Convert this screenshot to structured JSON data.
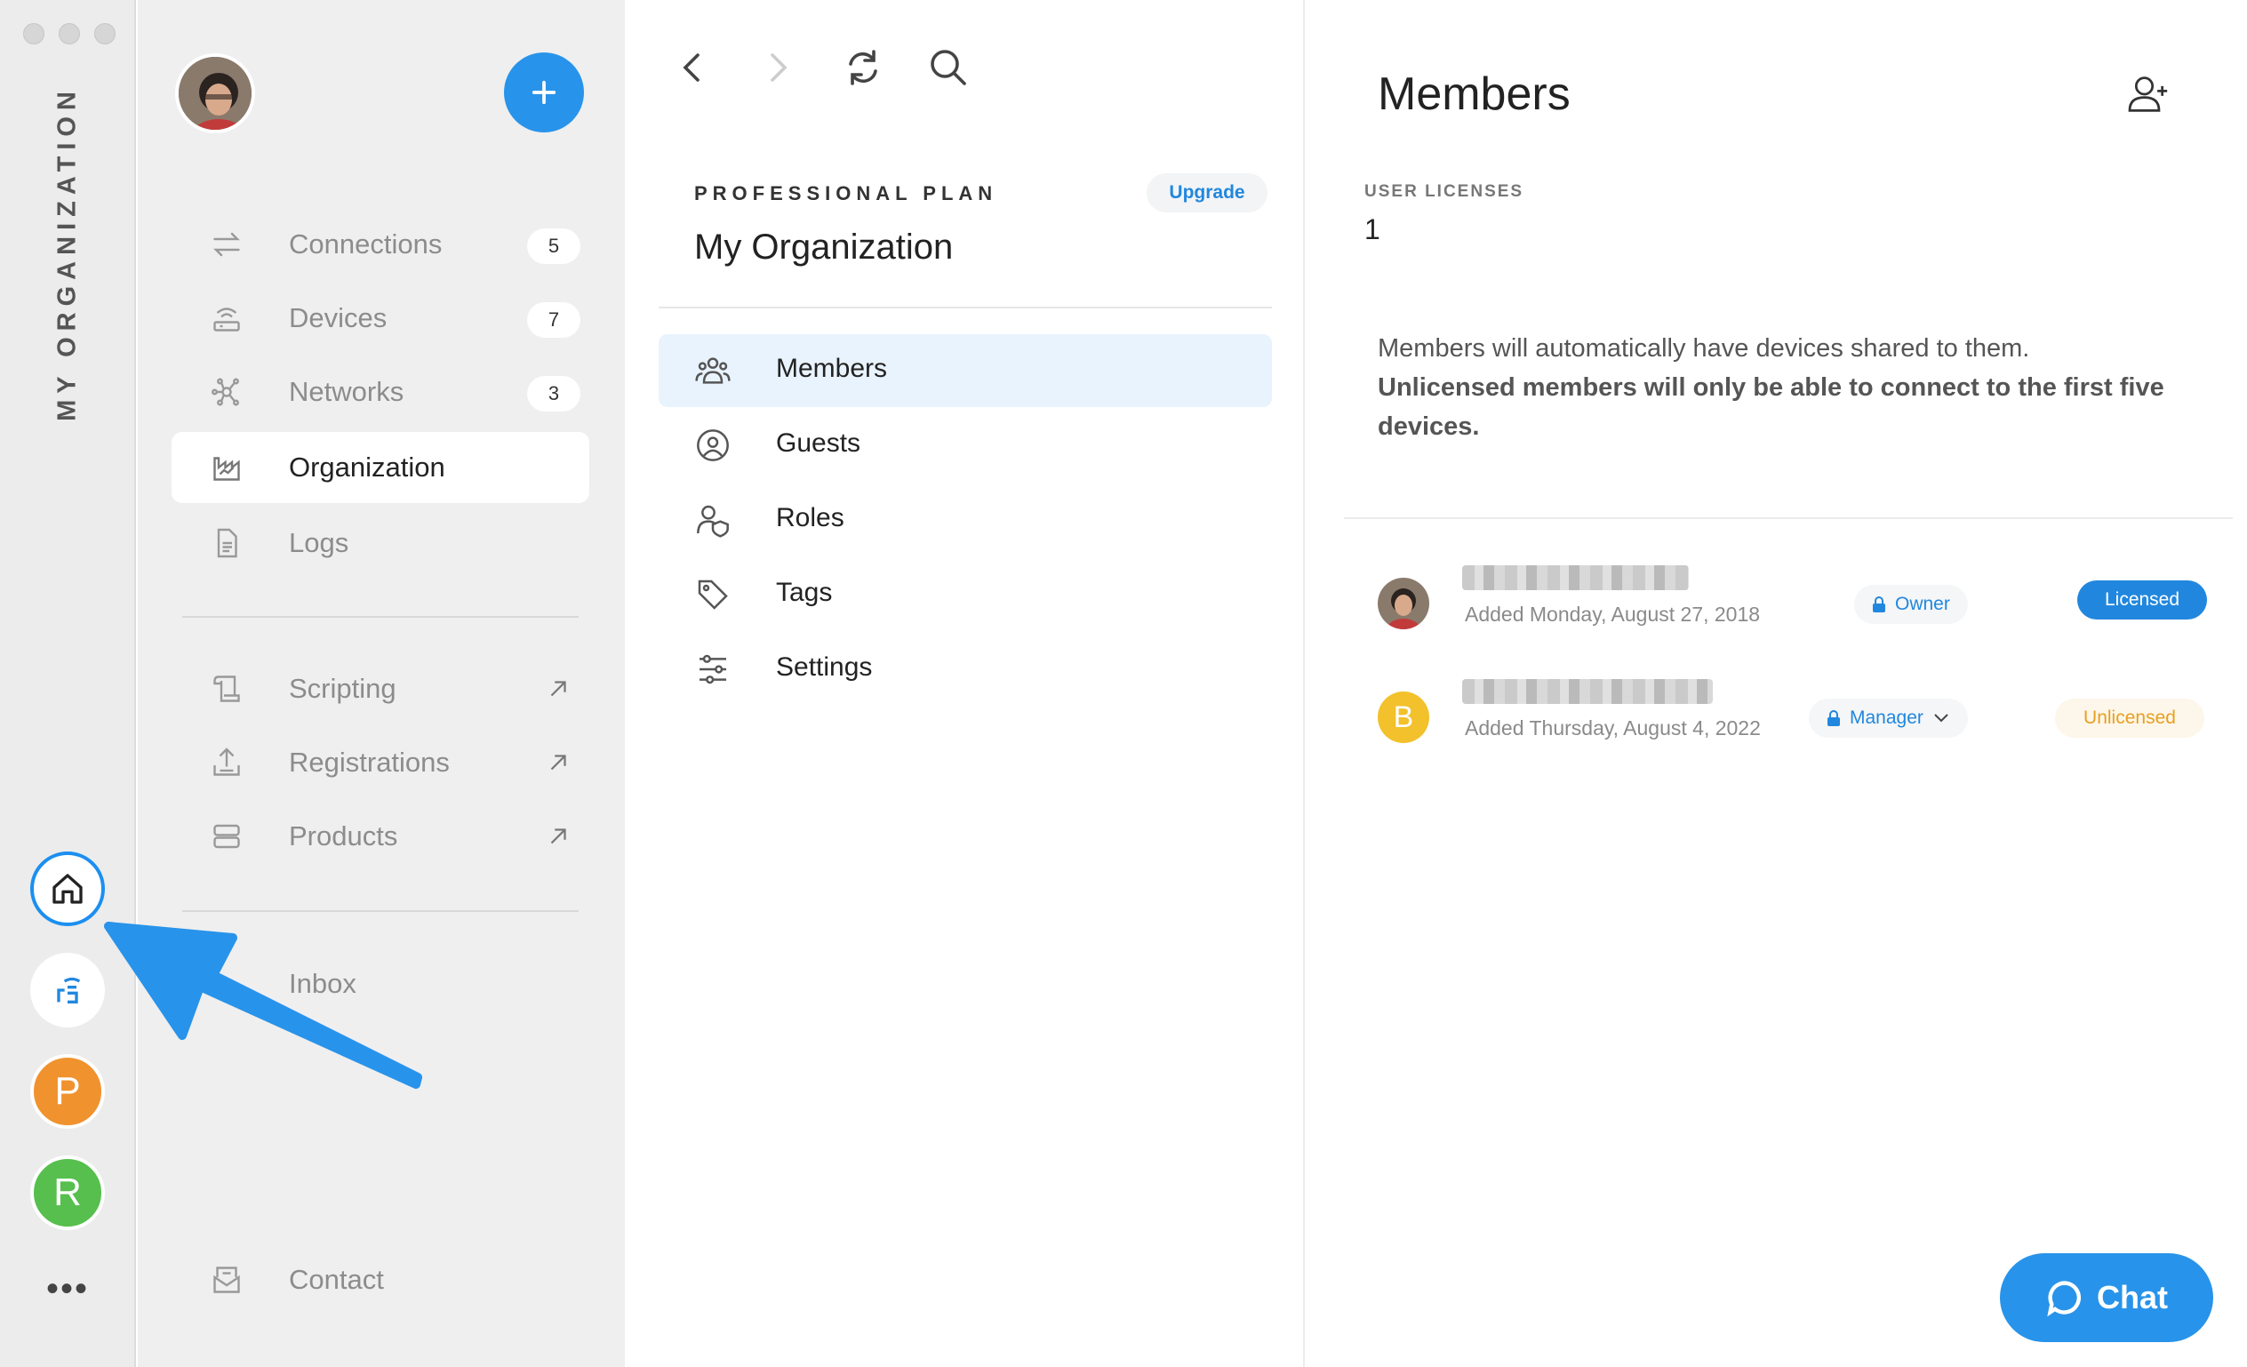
{
  "rail": {
    "title": "MY ORGANIZATION",
    "accounts": [
      {
        "letter": "P",
        "color": "#f0922e"
      },
      {
        "letter": "R",
        "color": "#56bf4d"
      }
    ],
    "more": "•••"
  },
  "nav": {
    "items": [
      {
        "label": "Connections",
        "count": "5",
        "icon": "arrows-swap-icon"
      },
      {
        "label": "Devices",
        "count": "7",
        "icon": "router-icon"
      },
      {
        "label": "Networks",
        "count": "3",
        "icon": "network-icon"
      },
      {
        "label": "Organization",
        "icon": "factory-icon",
        "active": true
      },
      {
        "label": "Logs",
        "icon": "document-icon"
      }
    ],
    "links": [
      {
        "label": "Scripting",
        "icon": "script-icon"
      },
      {
        "label": "Registrations",
        "icon": "upload-icon"
      },
      {
        "label": "Products",
        "icon": "server-icon"
      }
    ],
    "inbox": "Inbox",
    "contact": "Contact"
  },
  "middle": {
    "plan": "PROFESSIONAL PLAN",
    "upgrade": "Upgrade",
    "org_name": "My Organization",
    "menu": [
      {
        "label": "Members",
        "icon": "people-icon",
        "active": true
      },
      {
        "label": "Guests",
        "icon": "user-circle-icon"
      },
      {
        "label": "Roles",
        "icon": "user-shield-icon"
      },
      {
        "label": "Tags",
        "icon": "tag-icon"
      },
      {
        "label": "Settings",
        "icon": "sliders-icon"
      }
    ]
  },
  "members": {
    "title": "Members",
    "license_label": "USER LICENSES",
    "license_count": "1",
    "info_line1": "Members will automatically have devices shared to them.",
    "info_line2": "Unlicensed members will only be able to connect to the first five devices.",
    "list": [
      {
        "date": "Added Monday, August 27, 2018",
        "role": "Owner",
        "status": "Licensed"
      },
      {
        "initial": "B",
        "date": "Added Thursday, August 4, 2022",
        "role": "Manager",
        "status": "Unlicensed"
      }
    ]
  },
  "chat": {
    "label": "Chat"
  },
  "colors": {
    "accent": "#2893ea",
    "licensed": "#2187de",
    "unlicensed": "#e7a020"
  }
}
